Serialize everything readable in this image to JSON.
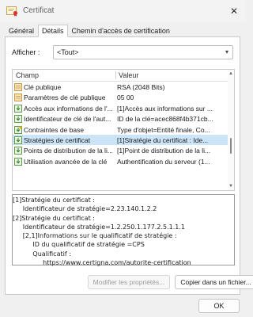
{
  "window": {
    "title": "Certificat"
  },
  "tabs": [
    {
      "label": "Général"
    },
    {
      "label": "Détails"
    },
    {
      "label": "Chemin d'accès de certification"
    }
  ],
  "show": {
    "label": "Afficher :",
    "value": "<Tout>"
  },
  "grid": {
    "headers": {
      "field": "Champ",
      "value": "Valeur"
    },
    "rows": [
      {
        "field": "Clé publique",
        "value": "RSA (2048 Bits)",
        "icon": "field-icon"
      },
      {
        "field": "Paramètres de clé publique",
        "value": "05 00",
        "icon": "field-icon"
      },
      {
        "field": "Accès aux informations de l'...",
        "value": "[1]Accès aux informations sur ...",
        "icon": "extension-icon"
      },
      {
        "field": "Identificateur de clé de l'aut...",
        "value": "ID de la clé=acec868f4b371cb...",
        "icon": "extension-icon"
      },
      {
        "field": "Contraintes de base",
        "value": "Type d'objet=Entité finale, Co...",
        "icon": "critical-extension-icon"
      },
      {
        "field": "Stratégies de certificat",
        "value": "[1]Stratégie du certificat : Ide...",
        "icon": "extension-icon"
      },
      {
        "field": "Points de distribution de la li...",
        "value": "[1]Point de distribution de la li...",
        "icon": "extension-icon"
      },
      {
        "field": "Utilisation avancée de la clé",
        "value": "Authentification du serveur (1...",
        "icon": "extension-icon"
      }
    ]
  },
  "details": {
    "lines": [
      "[1]Stratégie du certificat :",
      "     Identificateur de stratégie=2.23.140.1.2.2",
      "[2]Stratégie du certificat :",
      "     Identificateur de stratégie=1.2.250.1.177.2.5.1.1.1",
      "     [2,1]Informations sur le qualificatif de stratégie :",
      "          ID du qualificatif de stratégie =CPS",
      "          Qualificatif :",
      "               https://www.certigna.com/autorite-certification"
    ]
  },
  "buttons": {
    "edit_properties": "Modifier les propriétés...",
    "copy_to_file": "Copier dans un fichier...",
    "ok": "OK"
  }
}
